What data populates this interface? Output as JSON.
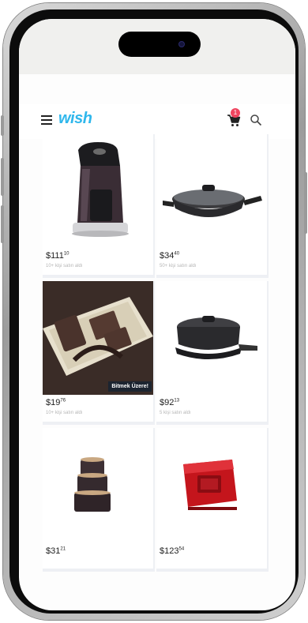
{
  "app": {
    "logo_text": "wish",
    "cart_count": "1"
  },
  "colors": {
    "brand": "#2fb7ec",
    "badge": "#f0455f"
  },
  "products": [
    {
      "price_main": "$111",
      "price_cents": "10",
      "sold_text": "10+ kişi satın aldı"
    },
    {
      "price_main": "$34",
      "price_cents": "40",
      "sold_text": "50+ kişi satın aldı"
    },
    {
      "price_main": "$19",
      "price_cents": "76",
      "sold_text": "10+ kişi satın aldı",
      "badge": "Bitmek Üzere!"
    },
    {
      "price_main": "$92",
      "price_cents": "13",
      "sold_text": "5 kişi satın aldı"
    },
    {
      "price_main": "$31",
      "price_cents": "21",
      "sold_text": ""
    },
    {
      "price_main": "$123",
      "price_cents": "54",
      "sold_text": ""
    }
  ],
  "icons": [
    "menu-icon",
    "cart-icon",
    "search-icon",
    "front-camera-icon"
  ]
}
